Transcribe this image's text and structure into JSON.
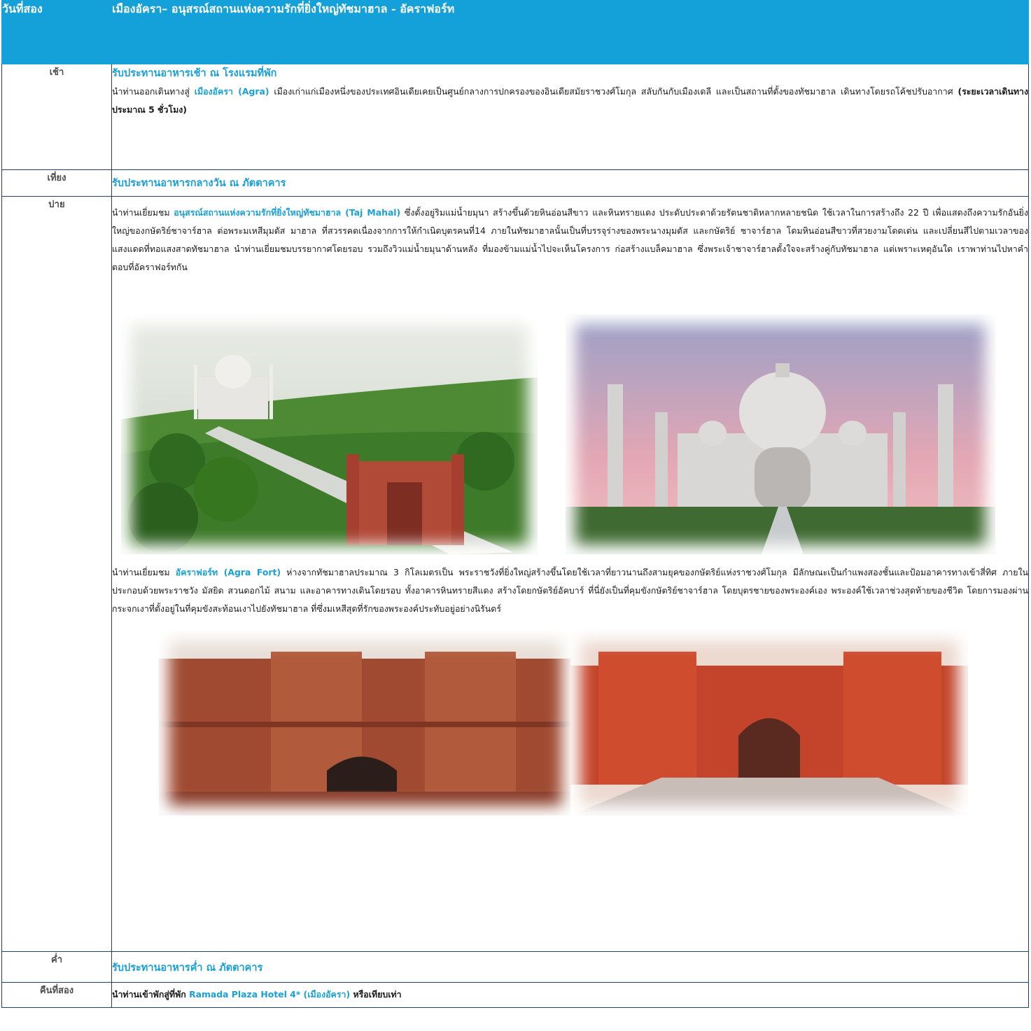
{
  "day": {
    "label": "วันที่สอง",
    "title": "เมืองอัครา– อนุสรณ์สถานแห่งความรักที่ยิ่งใหญ่ทัชมาฮาล - อัคราฟอร์ท"
  },
  "morning": {
    "label": "เช้า",
    "meal": "รับประทานอาหารเช้า ณ โรงแรมที่พัก",
    "p_pre": "นำท่านออกเดินทางสู่ ",
    "p_hl": "เมืองอัครา (Agra)",
    "p_post": " เมืองเก่าแก่เมืองหนึ่งของประเทศอินเดียเคยเป็นศูนย์กลางการปกครองของอินเดียสมัยราชวงศ์โมกุล สลับกันกับเมืองเดลี และเป็นสถานที่ตั้งของทัชมาฮาล เดินทางโดยรถโค้ชปรับอากาศ ",
    "p_bold": "(ระยะเวลาเดินทางประมาณ 5 ชั่วโมง)"
  },
  "noon": {
    "label": "เที่ยง",
    "meal": "รับประทานอาหารกลางวัน ณ ภัตตาคาร"
  },
  "afternoon": {
    "label": "บ่าย",
    "p1_pre": "นำท่านเยี่ยมชม ",
    "p1_hl": "อนุสรณ์สถานแห่งความรักที่ยิ่งใหญ่ทัชมาฮาล (Taj Mahal)",
    "p1_post": " ซึ่งตั้งอยู่ริมแม่น้ำยมุนา สร้างขึ้นด้วยหินอ่อนสีขาว และหินทรายแดง ประดับประดาด้วยรัตนชาติหลากหลายชนิด ใช้เวลาในการสร้างถึง 22 ปี เพื่อแสดงถึงความรักอันยิ่งใหญ่ของกษัตริย์ชาจาร์ฮาล ต่อพระมเหสีมุมตัส มาฮาล ที่สวรรคตเนื่องจากการให้กำเนิดบุตรคนที่14 ภายในทัชมาฮาลนั้นเป็นที่บรรจุร่างของพระนางมุมตัส และกษัตริย์ ชาจาร์ฮาล โดมหินอ่อนสีขาวที่สวยงามโดดเด่น และเปลี่ยนสีไปตามเวลาของแสงแดดที่ทอแสงสาดทัชมาฮาล นำท่านเยี่ยมชมบรรยากาศโดยรอบ รวมถึงวิวแม่น้ำยมุนาด้านหลัง ที่มองข้ามแม่น้ำไปจะเห็นโครงการ ก่อสร้างแบล็คมาฮาล ซึ่งพระเจ้าชาจาร์ฮาลตั้งใจจะสร้างคู่กับทัชมาฮาล แต่เพราะเหตุอันใด เราพาท่านไปหาคำตอบที่อัคราฟอร์ทกัน",
    "p2_pre": "นำท่านเยี่ยมชม ",
    "p2_hl": "อัคราฟอร์ท (Agra Fort)",
    "p2_post": " ห่างจากทัชมาฮาลประมาณ 3 กิโลเมตรเป็น พระราชวังที่ยิ่งใหญ่สร้างขึ้นโดยใช้เวลาที่ยาวนานถึงสามยุคของกษัตริย์แห่งราชวงศ์โมกุล มีลักษณะเป็นกำแพงสองชั้นและป้อมอาคารทางเข้าสี่ทิศ ภายในประกอบด้วยพระราชวัง มัสยิด สวนดอกไม้ สนาม และอาคารทางเดินโดยรอบ ทั้งอาคารหินทรายสีแดง สร้างโดยกษัตริย์อัคบาร์ ที่นี่ยังเป็นที่คุมขังกษัตริย์ชาจาร์ฮาล โดยบุตรชายของพระองค์เอง พระองค์ใช้เวลาช่วงสุดท้ายของชีวิต โดยการมองผ่านกระจกเงาที่ตั้งอยู่ในที่คุมขังสะท้อนเงาไปยังทัชมาฮาล ที่ซึ่งมเหสีสุดที่รักของพระองค์ประทับอยู่อย่างนิรันดร์"
  },
  "evening": {
    "label": "ค่ำ",
    "meal": "รับประทานอาหารค่ำ ณ ภัตตาคาร"
  },
  "night": {
    "label": "คืนที่สอง",
    "pre": "นำท่านเข้าพักสู่ที่พัก ",
    "hl": "Ramada Plaza Hotel 4* (เมืองอัครา)",
    "post": " หรือเทียบเท่า"
  },
  "colors": {
    "header_bg": "#14a0d9",
    "accent": "#1aa0d6",
    "border": "#1f3f6e"
  }
}
